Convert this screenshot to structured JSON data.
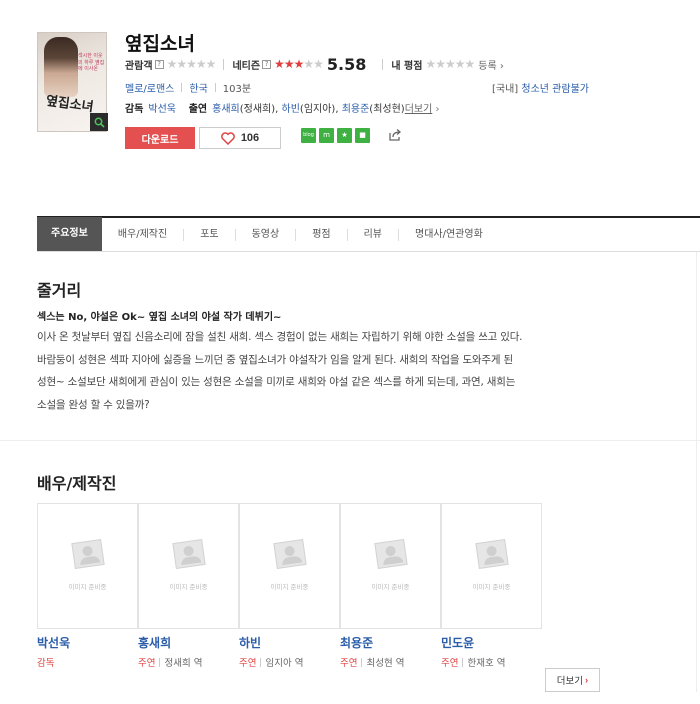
{
  "movie": {
    "title": "옆집소녀",
    "poster_title": "옆집소녀",
    "poster_tagline": "섹시한 이웃의 하루 옆집에 이사온",
    "zoom_icon": "magnifier-icon"
  },
  "ratings": {
    "audience_label": "관람객",
    "audience_stars": 0,
    "netizen_label": "네티즌",
    "netizen_stars": 3,
    "netizen_score": "5.58",
    "my_label": "내 평점",
    "register": "등록",
    "help_glyph": "?"
  },
  "info": {
    "genre": "멜로/로맨스",
    "country": "한국",
    "runtime": "103분",
    "grade_prefix": "[국내]",
    "grade": "청소년 관람불가",
    "director_label": "감독",
    "director": "박선욱",
    "cast_label": "출연",
    "cast_text": [
      {
        "name": "홍새희",
        "role": "(정새희)"
      },
      {
        "name": "하빈",
        "role": "(임지아)"
      },
      {
        "name": "최용준",
        "role": "(최성현)"
      }
    ],
    "more": "더보기"
  },
  "actions": {
    "download": "다운로드",
    "likes": "106",
    "sns": [
      "blog",
      "m",
      "★",
      "■"
    ],
    "share_icon": "share-icon",
    "colors": {
      "download": "#e45050",
      "sns": "#3fb143",
      "link": "#2a5caa"
    }
  },
  "tabs": [
    {
      "label": "주요정보",
      "active": true
    },
    {
      "label": "배우/제작진"
    },
    {
      "label": "포토"
    },
    {
      "label": "동영상"
    },
    {
      "label": "평점"
    },
    {
      "label": "리뷰"
    },
    {
      "label": "명대사/연관영화"
    }
  ],
  "synopsis": {
    "heading": "줄거리",
    "tagline": "섹스는 No, 야설은 Ok~ 옆집 소녀의 야설 작가 데뷔기~",
    "lines": [
      "이사 온 첫날부터 옆집 신음소리에 잠을 설친 새희. 섹스 경험이 없는 새희는 자립하기 위해 야한 소설을 쓰고 있다.",
      "바람둥이 성현은 섹파 지아에 싫증을 느끼던 중 옆집소녀가 야설작가 임을 알게 된다. 새희의 작업을 도와주게 된",
      "성현~ 소설보단 새희에게 관심이 있는 성현은 소설을 미끼로 새희와 야설 같은 섹스를 하게 되는데, 과연, 새희는",
      "소설을 완성 할 수 있을까?"
    ]
  },
  "cast_section": {
    "heading": "배우/제작진",
    "no_image": "이미지 준비중",
    "more": "더보기",
    "people": [
      {
        "name": "박선욱",
        "role": "감독",
        "character": ""
      },
      {
        "name": "홍새희",
        "role": "주연",
        "character": "정새희 역"
      },
      {
        "name": "하빈",
        "role": "주연",
        "character": "임지아 역"
      },
      {
        "name": "최용준",
        "role": "주연",
        "character": "최성현 역"
      },
      {
        "name": "민도윤",
        "role": "주연",
        "character": "한재호 역"
      }
    ]
  }
}
